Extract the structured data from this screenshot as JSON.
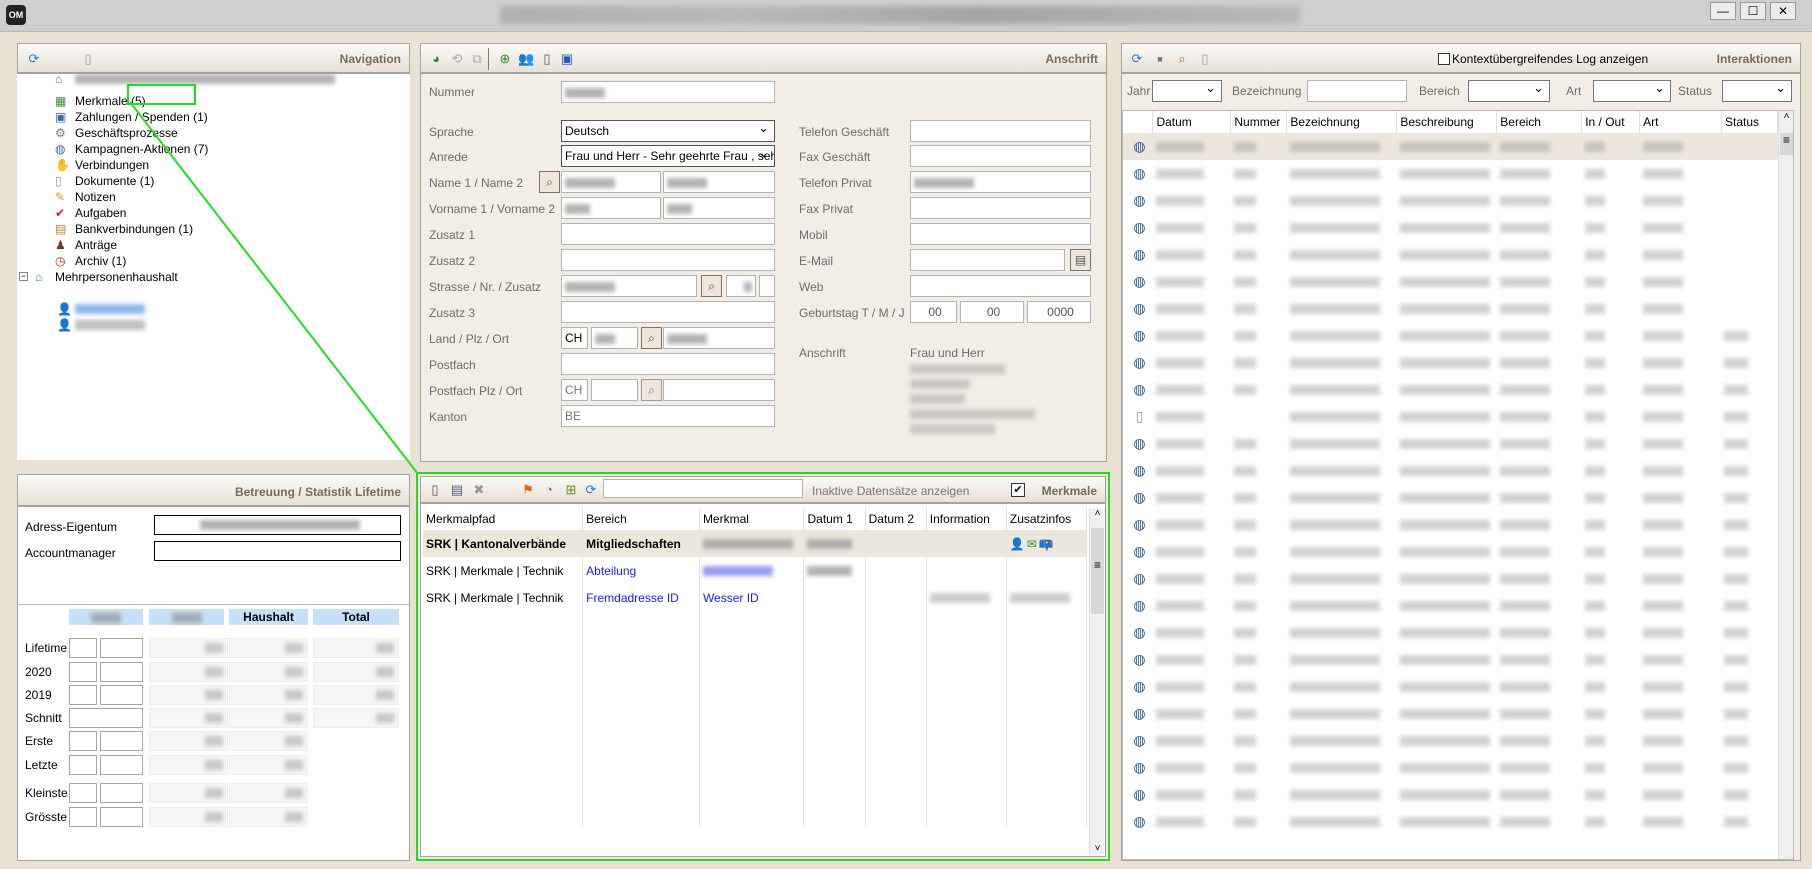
{
  "window": {
    "app_logo": "OM",
    "controls": [
      "—",
      "☐",
      "✕"
    ]
  },
  "navigation": {
    "title": "Navigation",
    "items": [
      {
        "label": "Merkmale (5)",
        "icon": "blocks-icon"
      },
      {
        "label": "Zahlungen / Spenden (1)",
        "icon": "payment-icon"
      },
      {
        "label": "Geschäftsprozesse",
        "icon": "gear-icon"
      },
      {
        "label": "Kampagnen-Aktionen (7)",
        "icon": "globe-icon"
      },
      {
        "label": "Verbindungen",
        "icon": "handshake-icon"
      },
      {
        "label": "Dokumente (1)",
        "icon": "document-icon"
      },
      {
        "label": "Notizen",
        "icon": "note-icon"
      },
      {
        "label": "Aufgaben",
        "icon": "checkmark-icon"
      },
      {
        "label": "Bankverbindungen (1)",
        "icon": "bank-icon"
      },
      {
        "label": "Anträge",
        "icon": "stamp-icon"
      },
      {
        "label": "Archiv (1)",
        "icon": "archive-icon"
      },
      {
        "label": "Mehrpersonenhaushalt",
        "icon": "house-icon"
      }
    ]
  },
  "anschrift": {
    "title": "Anschrift",
    "labels": {
      "nummer": "Nummer",
      "sprache": "Sprache",
      "anrede": "Anrede",
      "name": "Name 1 / Name 2",
      "vorname": "Vorname 1 / Vorname 2",
      "zusatz1": "Zusatz 1",
      "zusatz2": "Zusatz 2",
      "strasse": "Strasse / Nr. / Zusatz",
      "zusatz3": "Zusatz 3",
      "land": "Land / Plz / Ort",
      "postfach": "Postfach",
      "postfach_plz": "Postfach Plz / Ort",
      "kanton": "Kanton",
      "tel_geschaeft": "Telefon Geschäft",
      "fax_geschaeft": "Fax Geschäft",
      "tel_privat": "Telefon Privat",
      "fax_privat": "Fax Privat",
      "mobil": "Mobil",
      "email": "E-Mail",
      "web": "Web",
      "geburtstag": "Geburtstag T / M / J",
      "anschrift": "Anschrift"
    },
    "values": {
      "sprache": "Deutsch",
      "anrede": "Frau und Herr -  Sehr geehrte Frau , sehr",
      "land": "CH",
      "postfach_land": "CH",
      "kanton": "BE",
      "geb_t": "00",
      "geb_m": "00",
      "geb_j": "0000",
      "anschrift_line1": "Frau und Herr"
    }
  },
  "betreuung": {
    "title": "Betreuung / Statistik Lifetime",
    "labels": {
      "adress_eigentum": "Adress-Eigentum",
      "accountmanager": "Accountmanager"
    },
    "columns": {
      "haushalt": "Haushalt",
      "total": "Total"
    },
    "rows": [
      "Lifetime",
      "2020",
      "2019",
      "Schnitt",
      "Erste",
      "Letzte",
      "Kleinste",
      "Grösste"
    ]
  },
  "merkmale": {
    "title": "Merkmale",
    "search_value": "",
    "inactive_label": "Inaktive Datensätze anzeigen",
    "inactive_checked": true,
    "columns": [
      "Merkmalpfad",
      "Bereich",
      "Merkmal",
      "Datum 1",
      "Datum 2",
      "Information",
      "Zusatzinfos"
    ],
    "rows": [
      {
        "pfad": "SRK | Kantonalverbände",
        "bereich": "Mitgliedschaften",
        "merkmal": "",
        "bold": true,
        "selected": true
      },
      {
        "pfad": "SRK | Merkmale | Technik",
        "bereich": "Abteilung",
        "merkmal": ""
      },
      {
        "pfad": "SRK | Merkmale | Technik",
        "bereich": "Fremdadresse ID",
        "merkmal": "Wesser ID"
      }
    ],
    "link_color": "#1a1aff"
  },
  "interaktionen": {
    "title": "Interaktionen",
    "kontext_label": "Kontextübergreifendes Log anzeigen",
    "kontext_checked": false,
    "filters": {
      "jahr": "Jahr",
      "bezeichnung": "Bezeichnung",
      "bereich": "Bereich",
      "art": "Art",
      "status": "Status"
    },
    "columns": [
      "Datum",
      "Nummer",
      "Bezeichnung",
      "Beschreibung",
      "Bereich",
      "In / Out",
      "Art",
      "Status"
    ],
    "row_icons": [
      "globe",
      "globe",
      "globe",
      "globe",
      "globe",
      "globe",
      "globe",
      "globe",
      "globe",
      "globe",
      "document",
      "globe",
      "globe",
      "globe",
      "globe",
      "globe",
      "globe",
      "globe",
      "globe",
      "globe",
      "globe",
      "globe",
      "globe",
      "globe",
      "globe",
      "globe"
    ]
  },
  "colors": {
    "highlight": "#22dd22",
    "selected_row": "#ece6dc",
    "panel_title": "#7a6a5c",
    "stat_header": "#c6e0f7"
  }
}
